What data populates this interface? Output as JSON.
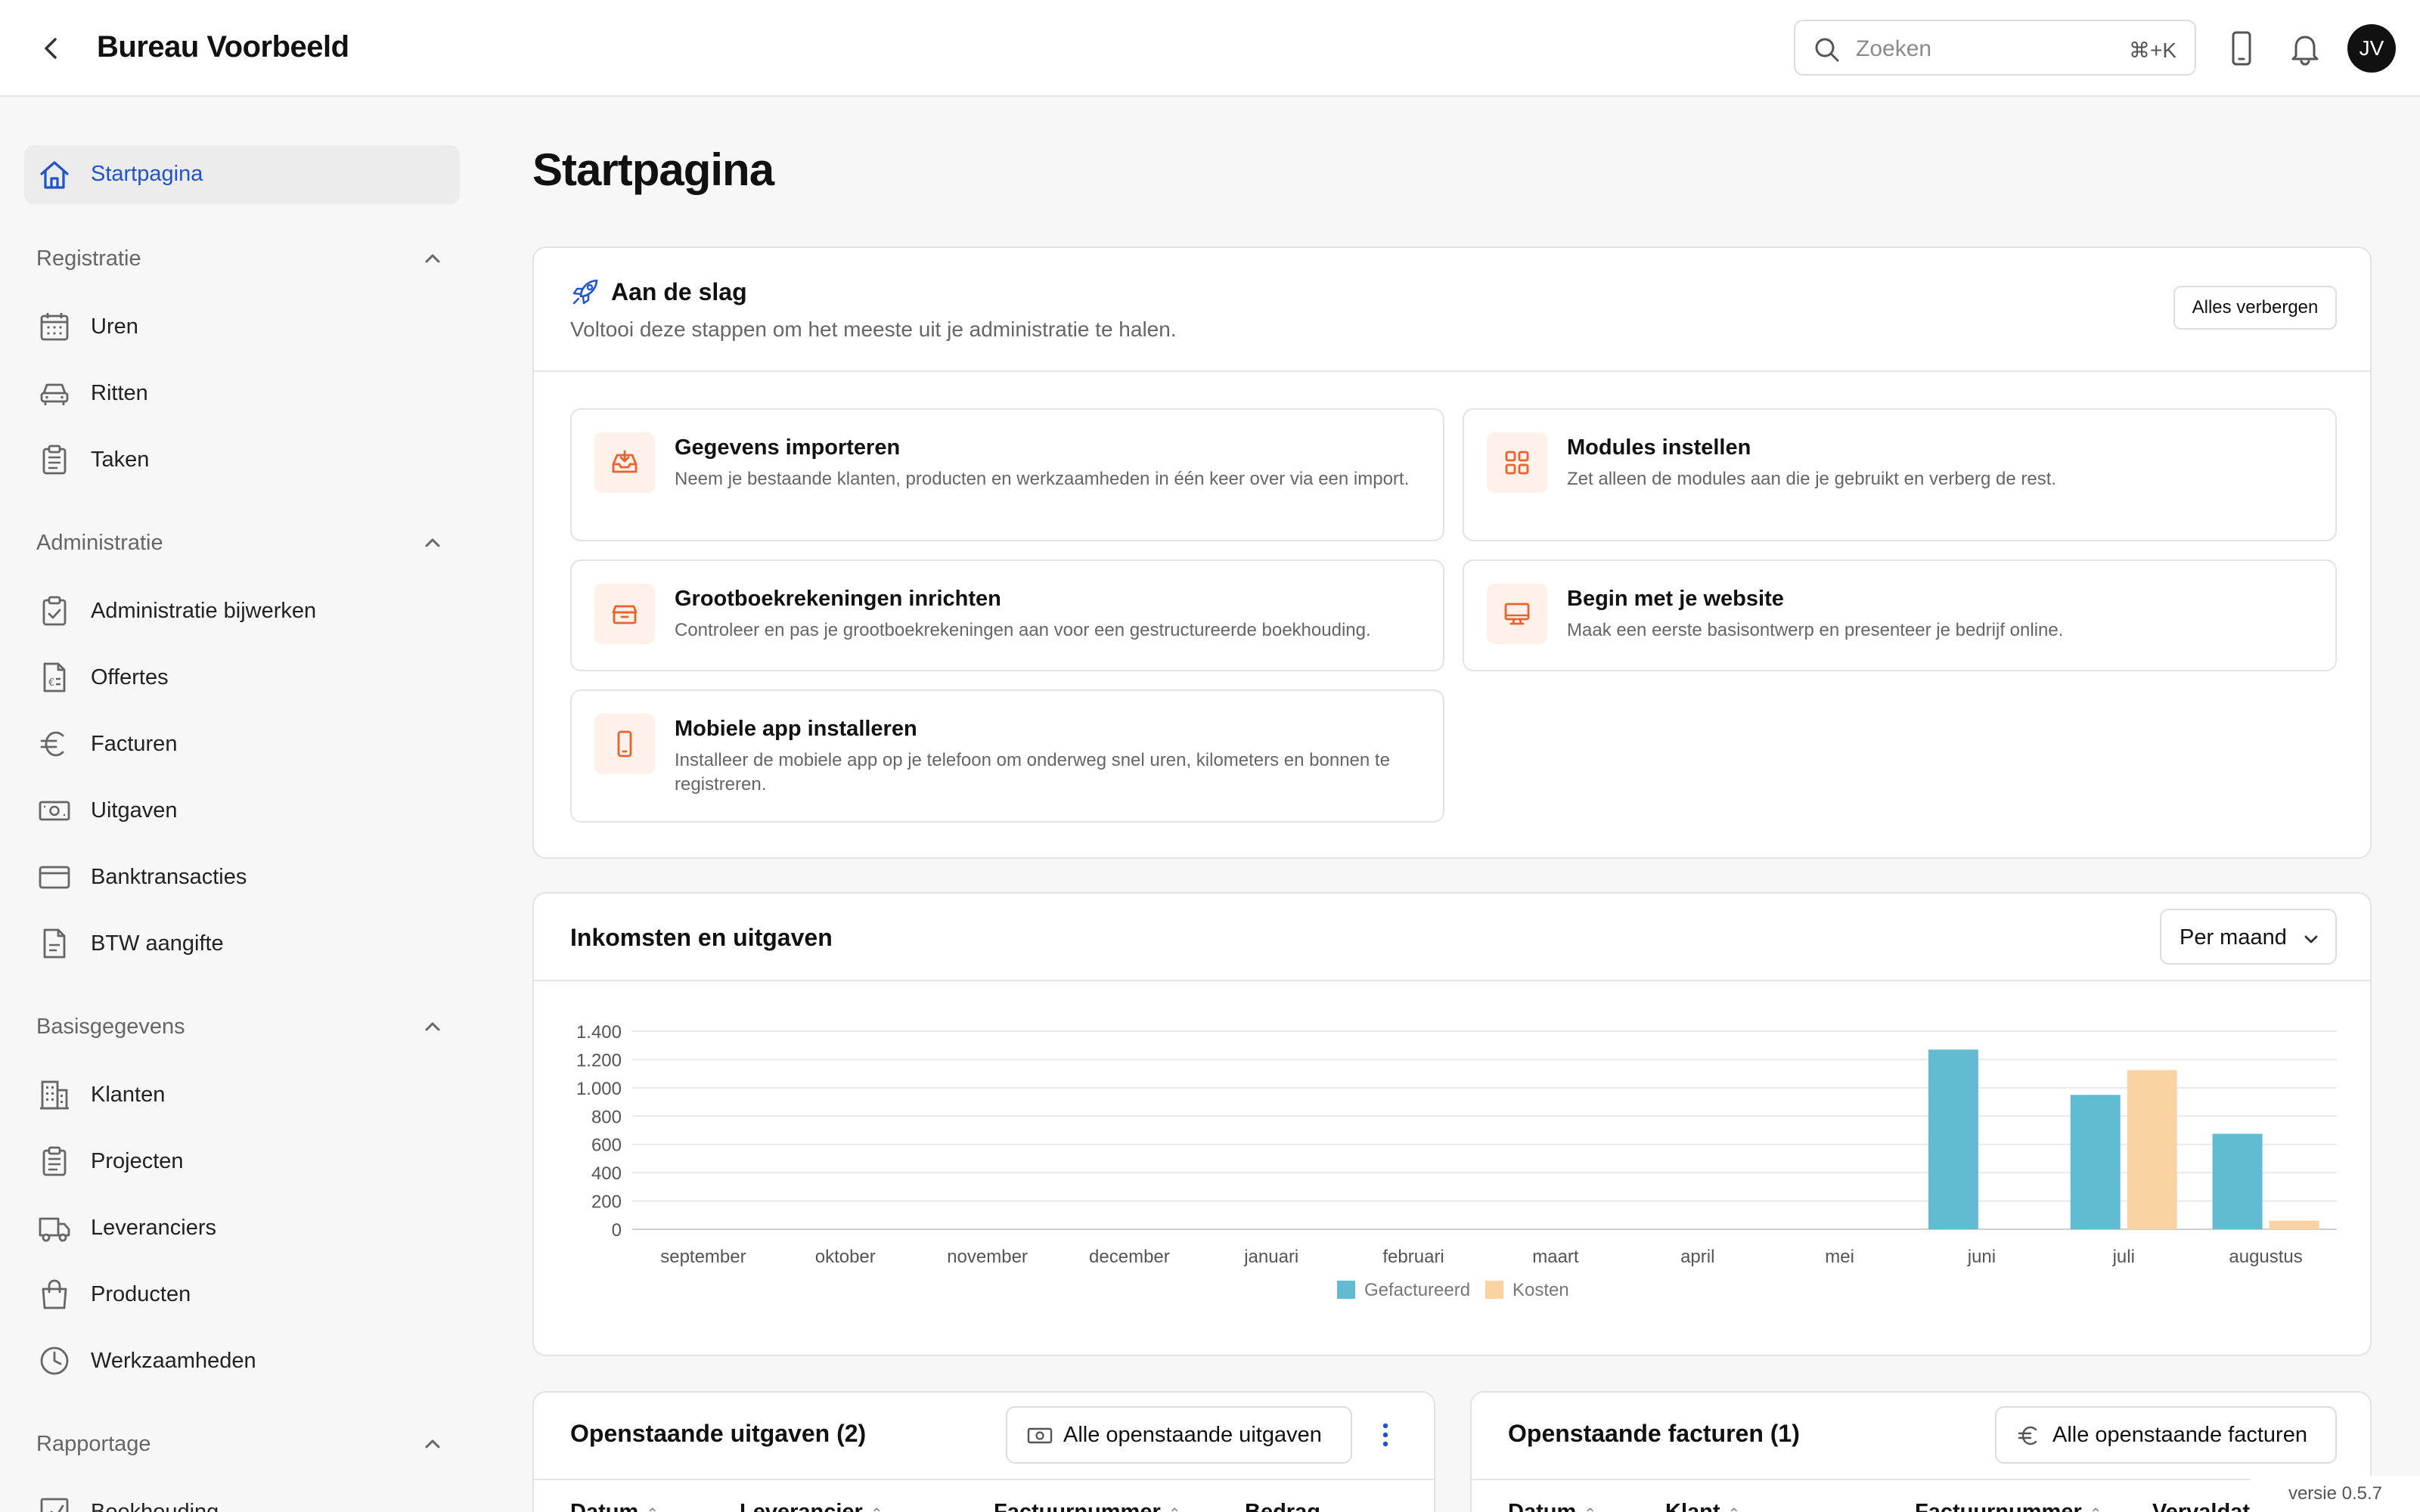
{
  "header": {
    "title": "Bureau Voorbeeld",
    "search_placeholder": "Zoeken",
    "search_shortcut": "⌘+K",
    "avatar_initials": "JV"
  },
  "sidebar": {
    "home_label": "Startpagina",
    "groups": [
      {
        "title": "Registratie",
        "items": [
          {
            "label": "Uren",
            "icon": "calendar-icon"
          },
          {
            "label": "Ritten",
            "icon": "car-icon"
          },
          {
            "label": "Taken",
            "icon": "clipboard-icon"
          }
        ]
      },
      {
        "title": "Administratie",
        "items": [
          {
            "label": "Administratie bijwerken",
            "icon": "clipboard-check-icon"
          },
          {
            "label": "Offertes",
            "icon": "document-icon"
          },
          {
            "label": "Facturen",
            "icon": "euro-icon"
          },
          {
            "label": "Uitgaven",
            "icon": "cash-icon"
          },
          {
            "label": "Banktransacties",
            "icon": "credit-card-icon"
          },
          {
            "label": "BTW aangifte",
            "icon": "file-icon"
          }
        ]
      },
      {
        "title": "Basisgegevens",
        "items": [
          {
            "label": "Klanten",
            "icon": "building-icon"
          },
          {
            "label": "Projecten",
            "icon": "clipboard-icon"
          },
          {
            "label": "Leveranciers",
            "icon": "truck-icon"
          },
          {
            "label": "Producten",
            "icon": "shopping-bag-icon"
          },
          {
            "label": "Werkzaamheden",
            "icon": "clock-icon"
          }
        ]
      },
      {
        "title": "Rapportage",
        "items": [
          {
            "label": "Boekhouding",
            "icon": "chart-icon"
          }
        ]
      }
    ]
  },
  "main": {
    "page_title": "Startpagina",
    "getting_started": {
      "title": "Aan de slag",
      "subtitle": "Voltooi deze stappen om het meeste uit je administratie te halen.",
      "hide_button": "Alles verbergen",
      "tasks": [
        {
          "title": "Gegevens importeren",
          "desc": "Neem je bestaande klanten, producten en werkzaamheden in één keer over via een import.",
          "icon": "inbox-icon"
        },
        {
          "title": "Modules instellen",
          "desc": "Zet alleen de modules aan die je gebruikt en verberg de rest.",
          "icon": "grid-icon"
        },
        {
          "title": "Grootboekrekeningen inrichten",
          "desc": "Controleer en pas je grootboekrekeningen aan voor een gestructureerde boekhouding.",
          "icon": "archive-icon"
        },
        {
          "title": "Begin met je website",
          "desc": "Maak een eerste basisontwerp en presenteer je bedrijf online.",
          "icon": "monitor-icon"
        },
        {
          "title": "Mobiele app installeren",
          "desc": "Installeer de mobiele app op je telefoon om onderweg snel uren, kilometers en bonnen te registreren.",
          "icon": "phone-icon"
        }
      ]
    },
    "income_chart": {
      "title": "Inkomsten en uitgaven",
      "period_select": "Per maand"
    },
    "open_expenses": {
      "title": "Openstaande uitgaven (2)",
      "button": "Alle openstaande uitgaven",
      "columns": [
        "Datum",
        "Leverancier",
        "Factuurnummer",
        "Bedrag"
      ]
    },
    "open_invoices": {
      "title": "Openstaande facturen (1)",
      "button": "Alle openstaande facturen",
      "columns": [
        "Datum",
        "Klant",
        "Factuurnummer",
        "Vervaldat"
      ]
    },
    "version": "versie 0.5.7"
  },
  "colors": {
    "accent": "#1f55c9",
    "task_icon": "#e8642c",
    "bar_invoiced": "#62bcd1",
    "bar_costs": "#fbd3a3"
  },
  "chart_data": {
    "type": "bar",
    "categories": [
      "september",
      "oktober",
      "november",
      "december",
      "januari",
      "februari",
      "maart",
      "april",
      "mei",
      "juni",
      "juli",
      "augustus"
    ],
    "series": [
      {
        "name": "Gefactureerd",
        "values": [
          0,
          0,
          0,
          0,
          0,
          0,
          0,
          0,
          0,
          1270,
          950,
          675
        ]
      },
      {
        "name": "Kosten",
        "values": [
          0,
          0,
          0,
          0,
          0,
          0,
          0,
          0,
          0,
          0,
          1125,
          60
        ]
      }
    ],
    "y_ticks": [
      "0",
      "200",
      "400",
      "600",
      "800",
      "1.000",
      "1.200",
      "1.400"
    ],
    "ylim": [
      0,
      1400
    ],
    "grid": true,
    "legend": "bottom"
  }
}
